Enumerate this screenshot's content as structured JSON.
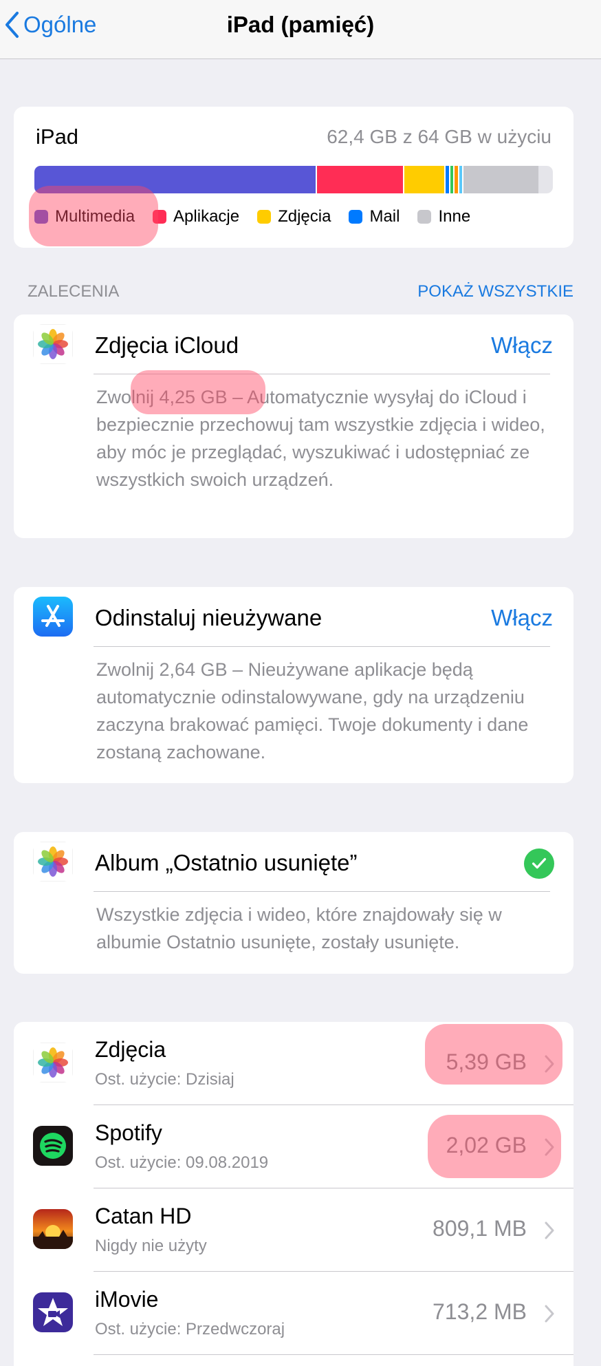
{
  "nav": {
    "back_label": "Ogólne",
    "title": "iPad (pamięć)"
  },
  "storage": {
    "device": "iPad",
    "used_text": "62,4 GB z 64 GB w użyciu",
    "segments": [
      {
        "name": "Multimedia",
        "fraction": 0.545,
        "color": "#5856d6"
      },
      {
        "name": "Aplikacje",
        "fraction": 0.168,
        "color": "#ff2d55"
      },
      {
        "name": "Zdjęcia",
        "fraction": 0.08,
        "color": "#ffcc00"
      },
      {
        "name": "Mail",
        "fraction": 0.01,
        "color": "#007aff"
      },
      {
        "name": "",
        "fraction": 0.008,
        "color": "#34c759"
      },
      {
        "name": "",
        "fraction": 0.008,
        "color": "#ff9500"
      },
      {
        "name": "",
        "fraction": 0.008,
        "color": "#5ac8fa"
      },
      {
        "name": "Inne",
        "fraction": 0.145,
        "color": "#c7c7cc"
      }
    ],
    "legend": [
      {
        "label": "Multimedia",
        "color": "#5856d6"
      },
      {
        "label": "Aplikacje",
        "color": "#ff2d55"
      },
      {
        "label": "Zdjęcia",
        "color": "#ffcc00"
      },
      {
        "label": "Mail",
        "color": "#007aff"
      },
      {
        "label": "Inne",
        "color": "#c7c7cc"
      }
    ]
  },
  "recommendations": {
    "header": "ZALECENIA",
    "show_all": "POKAŻ WSZYSTKIE",
    "items": [
      {
        "title": "Zdjęcia iCloud",
        "action": "Włącz",
        "icon": "photos-icon",
        "description": "Zwolnij 4,25 GB – Automatycznie wysyłaj do iCloud i bezpiecznie przechowuj tam wszystkie zdjęcia i wideo, aby móc je przeglądać, wyszukiwać i udostępniać ze wszystkich swoich urządzeń."
      },
      {
        "title": "Odinstaluj nieużywane",
        "action": "Włącz",
        "icon": "app-store-icon",
        "description": "Zwolnij 2,64 GB – Nieużywane aplikacje będą automatycznie odinstalowywane, gdy na urządzeniu zaczyna brakować pamięci. Twoje dokumenty i dane zostaną zachowane."
      },
      {
        "title": "Album „Ostatnio usunięte”",
        "icon": "photos-icon",
        "description": "Wszystkie zdjęcia i wideo, które znajdowały się w albumie Ostatnio usunięte, zostały usunięte."
      }
    ]
  },
  "apps": [
    {
      "name": "Zdjęcia",
      "last_used": "Ost. użycie: Dzisiaj",
      "size": "5,39 GB",
      "icon": "photos-icon"
    },
    {
      "name": "Spotify",
      "last_used": "Ost. użycie: 09.08.2019",
      "size": "2,02 GB",
      "icon": "spotify-icon"
    },
    {
      "name": "Catan HD",
      "last_used": "Nigdy nie użyty",
      "size": "809,1 MB",
      "icon": "catan-icon"
    },
    {
      "name": "iMovie",
      "last_used": "Ost. użycie: Przedwczoraj",
      "size": "713,2 MB",
      "icon": "imovie-icon"
    }
  ],
  "colors": {
    "accent": "#1a7ae0",
    "highlight": "#ff4664"
  }
}
